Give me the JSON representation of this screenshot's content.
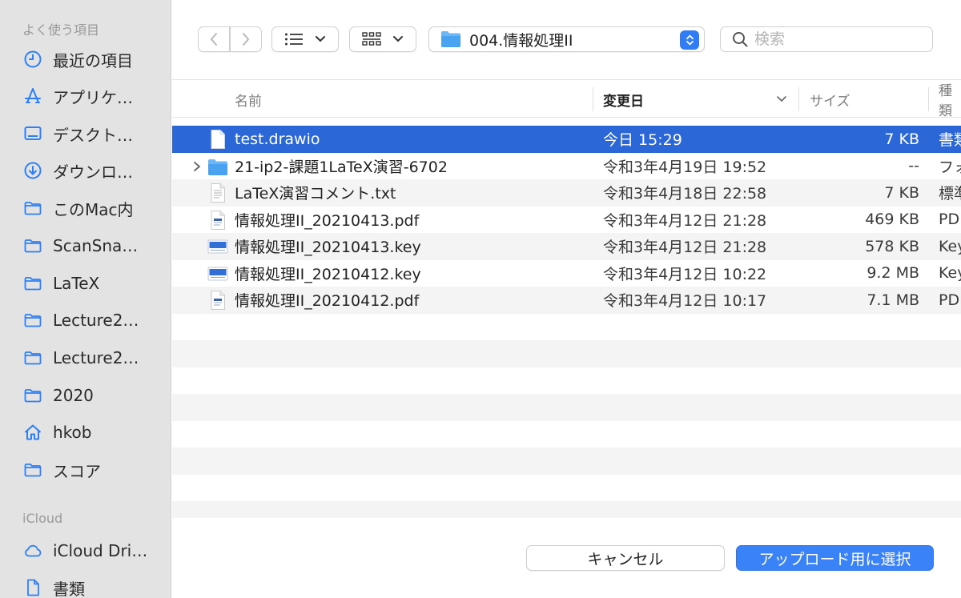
{
  "sidebar": {
    "favorites_label": "よく使う項目",
    "items": [
      {
        "label": "最近の項目",
        "icon": "clock-icon"
      },
      {
        "label": "アプリケ…",
        "icon": "applications-icon"
      },
      {
        "label": "デスクト…",
        "icon": "desktop-icon"
      },
      {
        "label": "ダウンロ…",
        "icon": "download-icon"
      },
      {
        "label": "このMac内",
        "icon": "folder-icon"
      },
      {
        "label": "ScanSna…",
        "icon": "folder-icon"
      },
      {
        "label": "LaTeX",
        "icon": "folder-icon"
      },
      {
        "label": "Lecture2…",
        "icon": "folder-icon"
      },
      {
        "label": "Lecture2…",
        "icon": "folder-icon"
      },
      {
        "label": "2020",
        "icon": "folder-icon"
      },
      {
        "label": "hkob",
        "icon": "home-icon"
      },
      {
        "label": "スコア",
        "icon": "folder-icon"
      }
    ],
    "icloud_label": "iCloud",
    "icloud_items": [
      {
        "label": "iCloud Dri…",
        "icon": "cloud-icon"
      },
      {
        "label": "書類",
        "icon": "document-icon"
      }
    ]
  },
  "toolbar": {
    "path_label": "004.情報処理II",
    "search_placeholder": "検索"
  },
  "columns": {
    "name": "名前",
    "date": "変更日",
    "size": "サイズ",
    "kind": "種類"
  },
  "files": [
    {
      "name": "test.drawio",
      "date": "今日 15:29",
      "size": "7 KB",
      "kind": "書類",
      "icon": "blank-document-icon",
      "selected": true
    },
    {
      "name": "21-ip2-課題1LaTeX演習-6702",
      "date": "令和3年4月19日 19:52",
      "size": "--",
      "kind": "フォルダ",
      "icon": "folder-icon",
      "folder": true
    },
    {
      "name": "LaTeX演習コメント.txt",
      "date": "令和3年4月18日 22:58",
      "size": "7 KB",
      "kind": "標準テキスト",
      "icon": "text-document-icon"
    },
    {
      "name": "情報処理II_20210413.pdf",
      "date": "令和3年4月12日 21:28",
      "size": "469 KB",
      "kind": "PDF",
      "icon": "pdf-document-icon"
    },
    {
      "name": "情報処理II_20210413.key",
      "date": "令和3年4月12日 21:28",
      "size": "578 KB",
      "kind": "Keynote",
      "icon": "keynote-document-icon"
    },
    {
      "name": "情報処理II_20210412.key",
      "date": "令和3年4月12日 10:22",
      "size": "9.2 MB",
      "kind": "Keynote",
      "icon": "keynote-document-icon"
    },
    {
      "name": "情報処理II_20210412.pdf",
      "date": "令和3年4月12日 10:17",
      "size": "7.1 MB",
      "kind": "PDF",
      "icon": "pdf-document-icon"
    }
  ],
  "footer": {
    "cancel_label": "キャンセル",
    "upload_label": "アップロード用に選択"
  },
  "colors": {
    "accent": "#3a82f7",
    "selection": "#2b67d6",
    "sidebar_icon": "#2d7ff5"
  }
}
